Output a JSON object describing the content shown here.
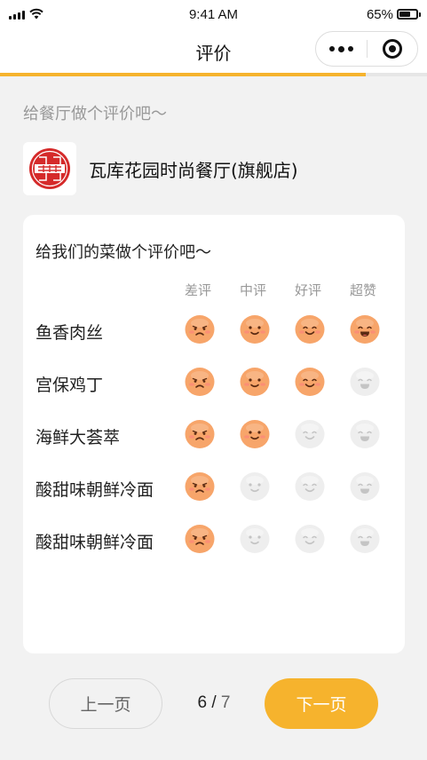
{
  "status_bar": {
    "time": "9:41 AM",
    "battery": "65%",
    "battery_level": 0.65
  },
  "nav": {
    "title": "评价"
  },
  "progress": {
    "value": 0.857
  },
  "hint": "给餐厅做个评价吧～",
  "restaurant": {
    "name": "瓦库花园时尚餐厅(旗舰店)"
  },
  "card": {
    "title": "给我们的菜做个评价吧～",
    "columns": [
      "差评",
      "中评",
      "好评",
      "超赞"
    ],
    "dishes": [
      {
        "name": "鱼香肉丝",
        "rating": 4
      },
      {
        "name": "宫保鸡丁",
        "rating": 3
      },
      {
        "name": "海鲜大荟萃",
        "rating": 2
      },
      {
        "name": "酸甜味朝鲜冷面",
        "rating": 1
      },
      {
        "name": "酸甜味朝鲜冷面",
        "rating": 1
      }
    ]
  },
  "footer": {
    "prev_label": "上一页",
    "next_label": "下一页",
    "current_page": "6",
    "separator": "/",
    "total_pages": "7"
  },
  "colors": {
    "accent": "#f6b32d",
    "face_active": "#f7a56a",
    "face_inactive": "#eeeeee",
    "background": "#f2f2f2"
  },
  "icons": {
    "face_expressions": [
      "frown",
      "smile",
      "happy",
      "laugh"
    ]
  }
}
